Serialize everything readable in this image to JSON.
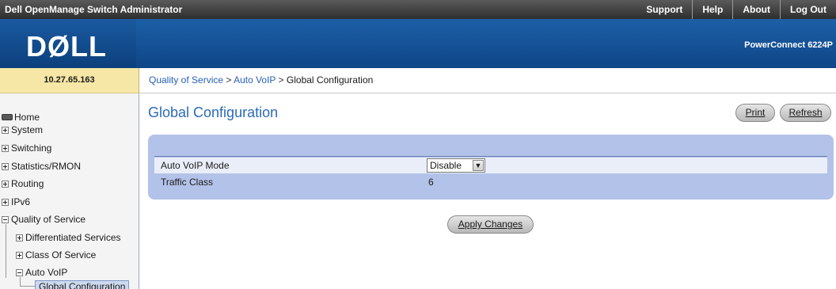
{
  "app": {
    "title": "Dell OpenManage Switch Administrator",
    "links": [
      "Support",
      "Help",
      "About",
      "Log Out"
    ],
    "logo": "DØLL",
    "model": "PowerConnect 6224P",
    "ip": "10.27.65.163"
  },
  "breadcrumb": {
    "items": [
      "Quality of Service",
      "Auto VoIP",
      "Global Configuration"
    ],
    "sep": " > "
  },
  "sidebar": {
    "home": "Home",
    "items": [
      "System",
      "Switching",
      "Statistics/RMON",
      "Routing",
      "IPv6",
      "Quality of Service"
    ],
    "qos_children": [
      "Differentiated Services",
      "Class Of Service",
      "Auto VoIP"
    ],
    "autovoip_children": [
      "Global Configuration"
    ]
  },
  "main": {
    "title": "Global Configuration",
    "print_label": "Print",
    "refresh_label": "Refresh",
    "apply_label": "Apply Changes",
    "rows": [
      {
        "label": "Auto VoIP Mode",
        "value": "Disable"
      },
      {
        "label": "Traffic Class",
        "value": "6"
      }
    ]
  },
  "colors": {
    "title_blue": "#2a6ab8",
    "link_blue": "#2860b4",
    "panel": "#b3c2e8",
    "dell_blue": "#1c5fa6",
    "ip_bg": "#f6e7a6"
  }
}
